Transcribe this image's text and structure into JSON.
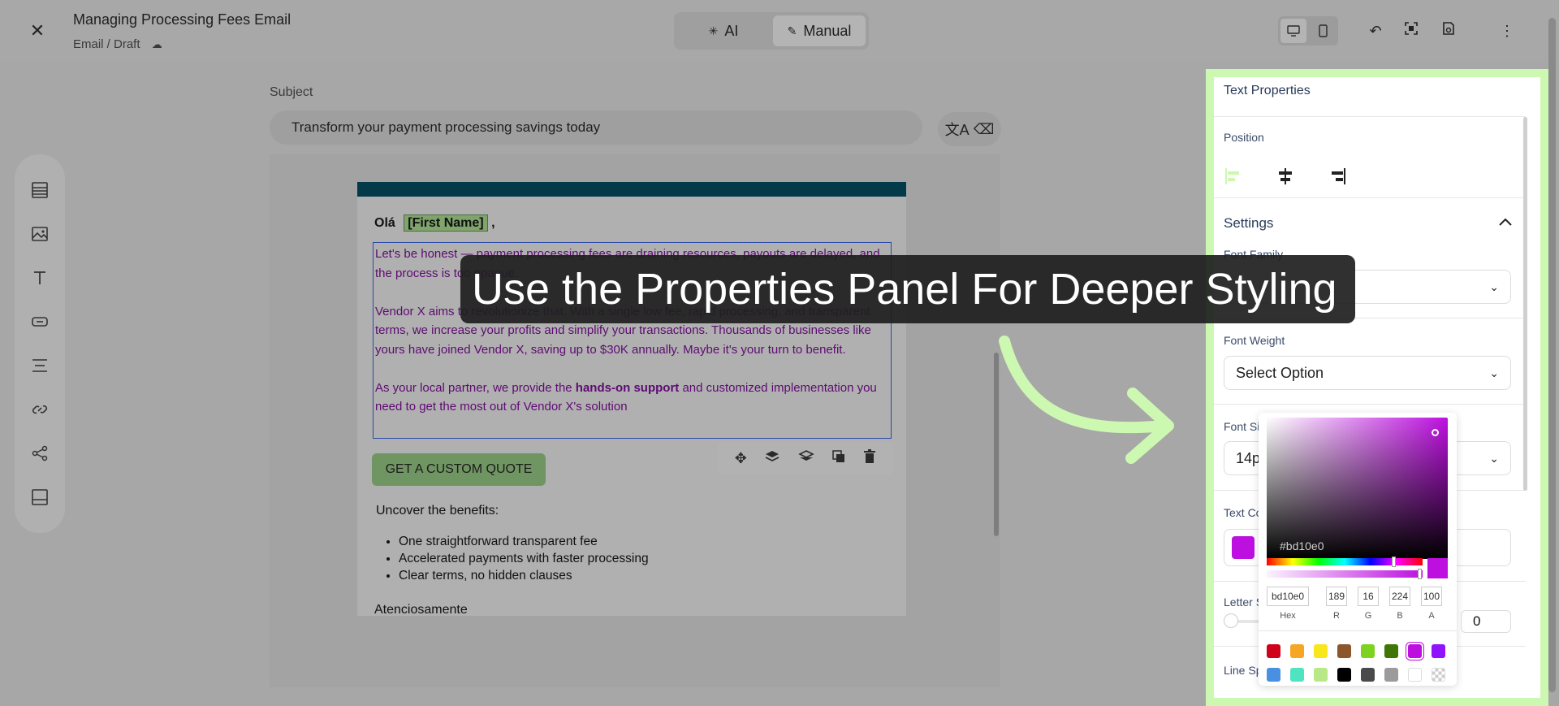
{
  "header": {
    "title": "Managing Processing Fees Email",
    "path": "Email / Draft",
    "modes": {
      "ai": "AI",
      "manual": "Manual"
    }
  },
  "subject": {
    "label": "Subject",
    "value": "Transform your payment processing savings today"
  },
  "email": {
    "greeting": "Olá",
    "merge_tag": "[First Name]",
    "greeting_suffix": ",",
    "para1": "Let's be honest — payment processing fees are draining resources, payouts are delayed, and the process is too opaque.",
    "para2": "Vendor X aims to revolutionize that. With a single low fee, rapid processing, and transparent terms, we increase your profits and simplify your transactions. Thousands of businesses like yours have joined Vendor X, saving up to $30K annually. Maybe it's your turn to benefit.",
    "para3_pre": "As your local partner, we provide the ",
    "para3_bold": "hands-on support",
    "para3_post": " and customized implementation you need to get the most out of Vendor X's solution",
    "cta": "GET A CUSTOM QUOTE",
    "benefits_title": "Uncover the benefits:",
    "benefits": [
      "One straightforward transparent fee",
      "Accelerated payments with faster processing",
      "Clear terms, no hidden clauses"
    ],
    "closing": "Atenciosamente"
  },
  "panel": {
    "title": "Text Properties",
    "position_label": "Position",
    "settings_label": "Settings",
    "font_family_label": "Font Family",
    "font_weight_label": "Font Weight",
    "font_weight_value": "Select Option",
    "font_size_label": "Font Size",
    "font_size_value": "14px",
    "text_color_label": "Text Color",
    "letter_spacing_label": "Letter Spacing",
    "letter_spacing_value": "0",
    "line_spacing_label": "Line Spacing",
    "text_color": "#bd10e0"
  },
  "picker": {
    "hex_ghost": "#bd10e0",
    "hex": "bd10e0",
    "r": "189",
    "g": "16",
    "b": "224",
    "a": "100",
    "labels": {
      "hex": "Hex",
      "r": "R",
      "g": "G",
      "b": "B",
      "a": "A"
    },
    "presets_row1": [
      "#d0021b",
      "#f5a623",
      "#f8e71c",
      "#8b572a",
      "#7ed321",
      "#417505",
      "#bd10e0",
      "#9013fe"
    ],
    "presets_row2": [
      "#4a90e2",
      "#50e3c2",
      "#b8e986",
      "#000000",
      "#4a4a4a",
      "#9b9b9b",
      "#ffffff",
      "transparent"
    ]
  },
  "callout": {
    "text": "Use the Properties Panel For Deeper Styling"
  }
}
